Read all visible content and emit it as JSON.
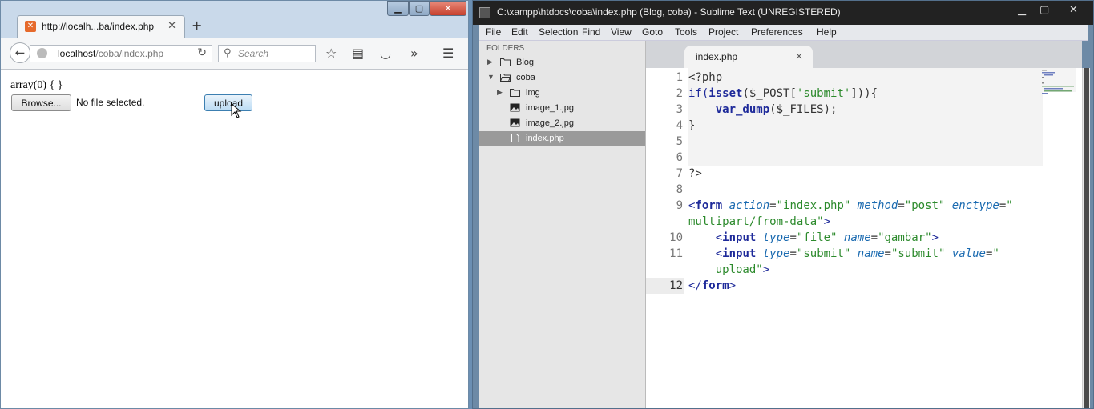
{
  "firefox": {
    "tab_title": "http://localh...ba/index.php",
    "favicon_letter": "⊠",
    "url_host": "localhost",
    "url_path": "/coba/index.php",
    "search_placeholder": "Search",
    "content": {
      "dump_text": "array(0) { }",
      "browse_label": "Browse...",
      "no_file_text": "No file selected.",
      "upload_label": "upload"
    }
  },
  "sublime": {
    "title": "C:\\xampp\\htdocs\\coba\\index.php (Blog, coba) - Sublime Text (UNREGISTERED)",
    "menu": [
      "File",
      "Edit",
      "Selection",
      "Find",
      "View",
      "Goto",
      "Tools",
      "Project",
      "Preferences",
      "Help"
    ],
    "sidebar": {
      "header": "FOLDERS",
      "items": [
        {
          "label": "Blog",
          "type": "folder",
          "expanded": false
        },
        {
          "label": "coba",
          "type": "folder",
          "expanded": true
        },
        {
          "label": "img",
          "type": "folder",
          "expanded": false
        },
        {
          "label": "image_1.jpg",
          "type": "image"
        },
        {
          "label": "image_2.jpg",
          "type": "image"
        },
        {
          "label": "index.php",
          "type": "file",
          "selected": true
        }
      ]
    },
    "tab": {
      "label": "index.php",
      "close": "×"
    },
    "line_numbers": [
      "1",
      "2",
      "3",
      "4",
      "5",
      "6",
      "7",
      "8",
      "9",
      "10",
      "11",
      "12"
    ],
    "code": {
      "l1": "<?php",
      "l2_a": "if(",
      "l2_b": "isset",
      "l2_c": "($_POST[",
      "l2_d": "'submit'",
      "l2_e": "])){",
      "l3_a": "    ",
      "l3_b": "var_dump",
      "l3_c": "($_FILES);",
      "l4": "}",
      "l7": "?>",
      "l9_a": "<",
      "l9_b": "form",
      "l9_c": " ",
      "l9_d": "action",
      "l9_e": "=",
      "l9_f": "\"index.php\"",
      "l9_g": " ",
      "l9_h": "method",
      "l9_i": "=",
      "l9_j": "\"post\"",
      "l9_k": " ",
      "l9_l": "enctype",
      "l9_m": "=",
      "l9_n": "\"",
      "l9w": "multipart/from-data\"",
      "l9w_end": ">",
      "l10_a": "    <",
      "l10_b": "input",
      "l10_c": " ",
      "l10_d": "type",
      "l10_e": "=",
      "l10_f": "\"file\"",
      "l10_g": " ",
      "l10_h": "name",
      "l10_i": "=",
      "l10_j": "\"gambar\"",
      "l10_k": ">",
      "l11_a": "    <",
      "l11_b": "input",
      "l11_c": " ",
      "l11_d": "type",
      "l11_e": "=",
      "l11_f": "\"submit\"",
      "l11_g": " ",
      "l11_h": "name",
      "l11_i": "=",
      "l11_j": "\"submit\"",
      "l11_k": " ",
      "l11_l": "value",
      "l11_m": "=",
      "l11_n": "\"",
      "l11w": "    upload\"",
      "l11w_end": ">",
      "l12_a": "</",
      "l12_b": "form",
      "l12_c": ">"
    }
  }
}
